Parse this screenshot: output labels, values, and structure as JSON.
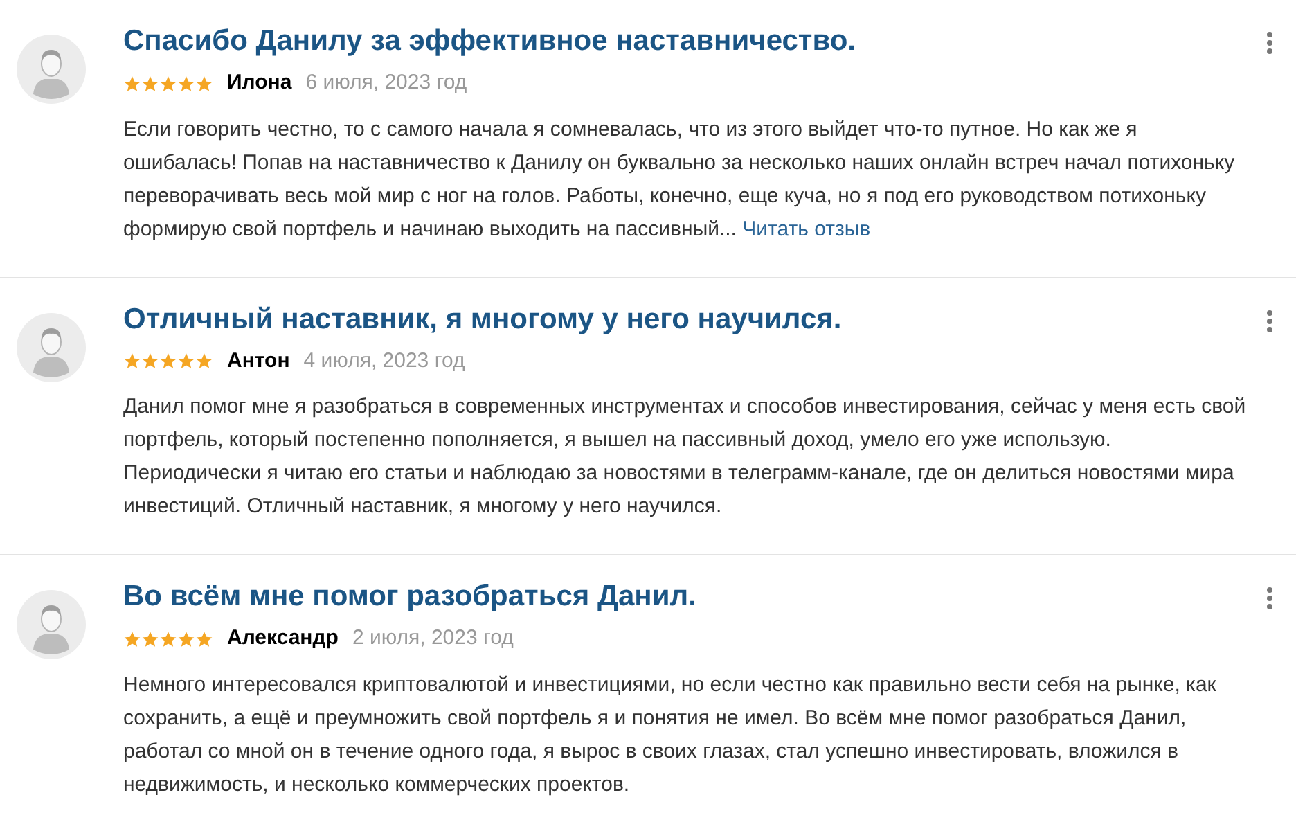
{
  "reviews": [
    {
      "title": "Спасибо Данилу за эффективное наставничество.",
      "stars": 5,
      "author": "Илона",
      "date": "6 июля, 2023 год",
      "text": "Если говорить честно, то с самого начала я сомневалась, что из этого выйдет что-то путное. Но как же я ошибалась! Попав на наставничество к Данилу он буквально за несколько наших онлайн встреч начал потихоньку переворачивать весь мой мир с ног на голов. Работы, конечно, еще куча, но я под его руководством потихоньку формирую свой портфель и начинаю выходить на пассивный...",
      "more": "Читать отзыв"
    },
    {
      "title": "Отличный наставник, я многому у него научился.",
      "stars": 5,
      "author": "Антон",
      "date": "4 июля, 2023 год",
      "text": "Данил помог мне я разобраться в современных инструментах и способов инвестирования, сейчас у меня есть свой портфель, который постепенно пополняется, я вышел на пассивный доход, умело его уже использую. Периодически я читаю его статьи и наблюдаю за новостями в телеграмм-канале, где он делиться новостями мира инвестиций. Отличный наставник, я многому у него научился."
    },
    {
      "title": "Во всём мне помог разобраться Данил.",
      "stars": 5,
      "author": "Александр",
      "date": "2 июля, 2023 год",
      "text": "Немного интересовался криптовалютой и инвестициями, но если честно как правильно вести себя на рынке, как сохранить, а ещё и преумножить свой портфель я и понятия не имел. Во всём мне помог разобраться Данил, работал со мной он в течение одного года, я вырос в своих глазах, стал успешно инвестировать, вложился в недвижимость, и несколько коммерческих проектов."
    }
  ]
}
